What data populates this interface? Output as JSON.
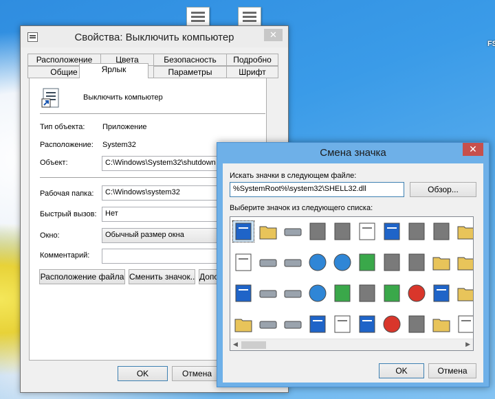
{
  "desktop": {
    "edge_text": "FS"
  },
  "props_window": {
    "title": "Свойства: Выключить компьютер",
    "tabs_top": [
      "Расположение",
      "Цвета",
      "Безопасность",
      "Подробно"
    ],
    "tabs_bottom": [
      "Общие",
      "Ярлык",
      "Параметры",
      "Шрифт"
    ],
    "active_tab": "Ярлык",
    "shortcut_name": "Выключить компьютер",
    "fields": {
      "type_label": "Тип объекта:",
      "type_value": "Приложение",
      "location_label": "Расположение:",
      "location_value": "System32",
      "object_label": "Объект:",
      "object_value": "C:\\Windows\\System32\\shutdown",
      "workdir_label": "Рабочая папка:",
      "workdir_value": "C:\\Windows\\system32",
      "hotkey_label": "Быстрый вызов:",
      "hotkey_value": "Нет",
      "window_label": "Окно:",
      "window_value": "Обычный размер окна",
      "comment_label": "Комментарий:",
      "comment_value": ""
    },
    "buttons": {
      "file_location": "Расположение файла",
      "change_icon": "Сменить значок...",
      "advanced": "Дополнительно...",
      "ok": "OK",
      "cancel": "Отмена"
    },
    "close_icon": "close-icon"
  },
  "change_icon_dialog": {
    "title": "Смена значка",
    "search_label": "Искать значки в следующем файле:",
    "file_path": "%SystemRoot%\\system32\\SHELL32.dll",
    "browse_button": "Обзор...",
    "list_label": "Выберите значок из следующего списка:",
    "icons": [
      [
        "blank-window-icon",
        "folder-icon",
        "drive-icon",
        "chip-icon",
        "printer-icon",
        "clock-document-icon",
        "display-settings-icon",
        "hand-icon",
        "recycle-bin-icon",
        "folder-grid-icon"
      ],
      [
        "document-icon",
        "server-icon",
        "network-drive-icon",
        "globe-icon",
        "network-globe-icon",
        "control-panel-icon",
        "cpu-icon",
        "shortcut-arrow-icon",
        "folder-share-icon",
        "disk-folder-icon"
      ],
      [
        "window-icon",
        "floppy-icon",
        "disconnected-drive-icon",
        "globe-mouse-icon",
        "network-icon",
        "search-icon",
        "network-share-icon",
        "power-icon-small",
        "monitor-icon",
        "folder-font-icon"
      ],
      [
        "open-folder-icon",
        "removable-drive-icon",
        "cd-drive-icon",
        "computer-icon",
        "calculator-icon",
        "help-icon",
        "shutdown-icon",
        "trash-icon",
        "tools-folder-icon",
        "checklist-icon"
      ]
    ],
    "buttons": {
      "ok": "OK",
      "cancel": "Отмена"
    },
    "close_icon": "close-icon"
  }
}
